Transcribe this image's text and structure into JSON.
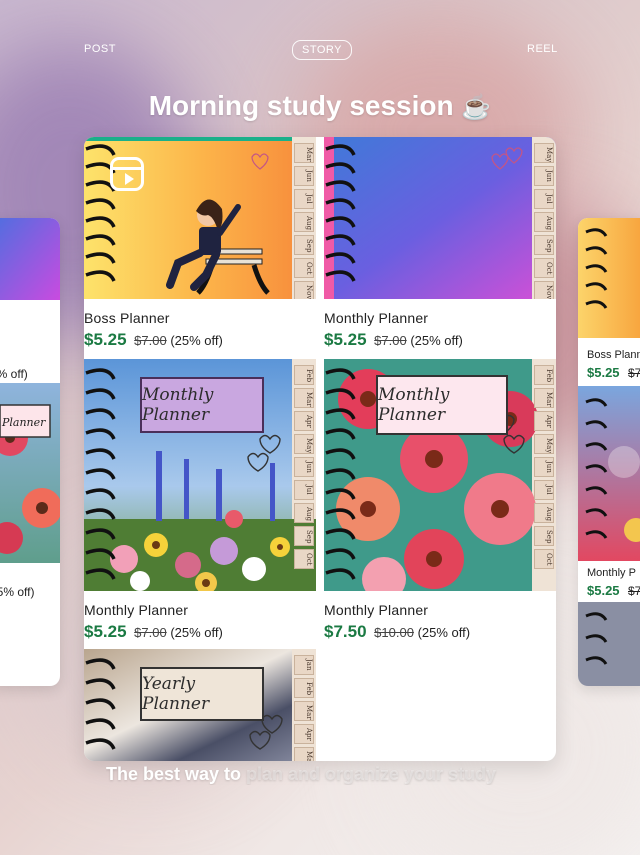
{
  "mode_tabs": {
    "post": "POST",
    "story": "STORY",
    "reel": "REEL"
  },
  "headline": {
    "text": "Morning study session",
    "emoji": "☕"
  },
  "products": [
    {
      "title": "Boss Planner",
      "sale_price": "$5.25",
      "original_price": "$7.00",
      "discount": "(25% off)"
    },
    {
      "title": "Monthly Planner",
      "sale_price": "$5.25",
      "original_price": "$7.00",
      "discount": "(25% off)"
    },
    {
      "title": "Monthly Planner",
      "sale_price": "$5.25",
      "original_price": "$7.00",
      "discount": "(25% off)",
      "cover_label": "Monthly Planner"
    },
    {
      "title": "Monthly Planner",
      "sale_price": "$7.50",
      "original_price": "$10.00",
      "discount": "(25% off)",
      "cover_label": "Monthly Planner"
    },
    {
      "cover_label": "Yearly Planner"
    }
  ],
  "month_tabs": {
    "boss": [
      "Mar",
      "Jun",
      "Jul",
      "Aug",
      "Sep",
      "Oct",
      "Nov"
    ],
    "monthly": [
      "May",
      "Jun",
      "Jul",
      "Aug",
      "Sep",
      "Oct",
      "Nov"
    ],
    "floral": [
      "Feb",
      "Mar",
      "Apr",
      "May",
      "Jun",
      "Jul",
      "Aug",
      "Sep",
      "Oct",
      "Nov"
    ],
    "yearly": [
      "Jan",
      "Feb",
      "Mar",
      "Apr",
      "May"
    ]
  },
  "left_card": {
    "discount_1": "5% off)",
    "discount_2": "25% off)",
    "cover_label": "Planner"
  },
  "right_card": {
    "title_1": "Boss Plann",
    "price_1": "$5.25",
    "orig_1": "$7",
    "title_2": "Monthly P",
    "price_2": "$5.25",
    "orig_2": "$7"
  },
  "caption": {
    "visible": "The best way to ",
    "faded": "plan and organize your study"
  },
  "colors": {
    "price_green": "#1b7a43",
    "boss_orange": "#f7a03a",
    "monthly_blue": "#3f63d8",
    "floral_red": "#e2445a"
  },
  "icons": {
    "reel": "reel-icon",
    "spiral": "spiral-binding-icon",
    "heart": "heart-doodle-icon"
  }
}
